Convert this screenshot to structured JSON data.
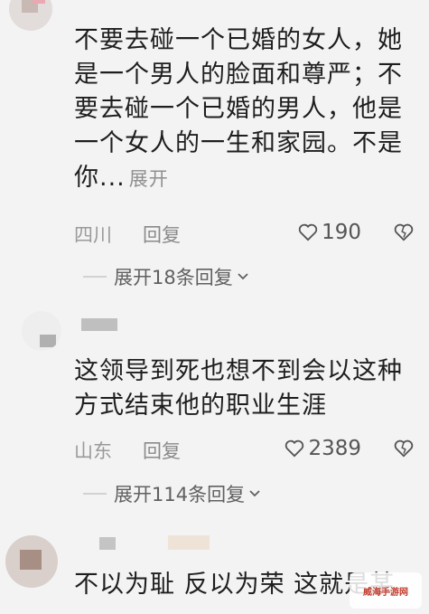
{
  "comments": [
    {
      "text": "不要去碰一个已婚的女人，她是一个男人的脸面和尊严；不要去碰一个已婚的男人，他是一个女人的一生和家园。不是你...",
      "expand_label": "展开",
      "location": "四川",
      "reply_label": "回复",
      "likes": "190",
      "replies_toggle": "展开18条回复"
    },
    {
      "text": "这领导到死也想不到会以这种方式结束他的职业生涯",
      "location": "山东",
      "reply_label": "回复",
      "likes": "2389",
      "replies_toggle": "展开114条回复"
    },
    {
      "text": "不以为耻 反以为荣 这就是某"
    }
  ],
  "colors": {
    "background": "#f3f3f3",
    "text": "#1e1e1e",
    "meta": "#9a9a9a",
    "like_icon": "#555555"
  },
  "icons": [
    "heart-icon",
    "dislike-heart-icon",
    "chevron-down-icon"
  ]
}
